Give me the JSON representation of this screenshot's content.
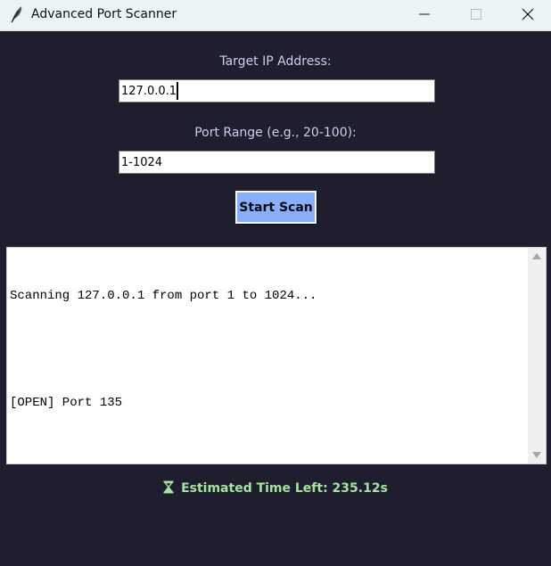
{
  "window": {
    "title": "Advanced Port Scanner",
    "icon": "feather-icon",
    "controls": [
      "minimize-icon",
      "maximize-icon",
      "close-icon"
    ]
  },
  "form": {
    "ip_label": "Target IP Address:",
    "ip_value": "127.0.0.1",
    "range_label": "Port Range (e.g., 20-100):",
    "range_value": "1-1024",
    "start_label": "Start Scan"
  },
  "log": {
    "lines": [
      "Scanning 127.0.0.1 from port 1 to 1024...",
      "",
      "[OPEN] Port 135"
    ]
  },
  "status": {
    "icon": "hourglass-icon",
    "text": "Estimated Time Left: 235.12s"
  },
  "colors": {
    "background": "#1e1e2e",
    "label": "#c7d0ee",
    "button": "#8aaef9",
    "status": "#a6e3a1"
  }
}
